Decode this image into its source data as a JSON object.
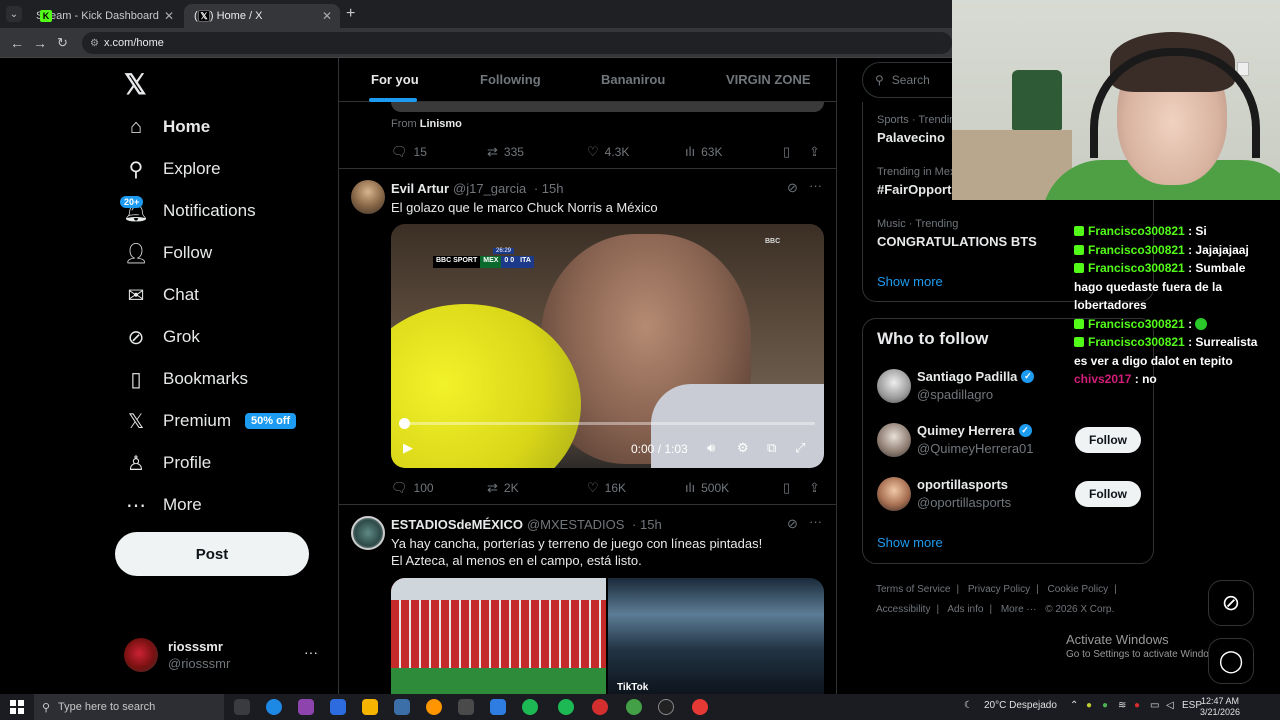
{
  "browser": {
    "tabs": [
      {
        "title": "Stream - Kick Dashboard",
        "active": false
      },
      {
        "title": "(21) Home / X",
        "active": true
      }
    ],
    "url": "x.com/home"
  },
  "nav": {
    "items": [
      {
        "label": "Home",
        "icon": "home-icon"
      },
      {
        "label": "Explore",
        "icon": "search-icon"
      },
      {
        "label": "Notifications",
        "icon": "bell-icon"
      },
      {
        "label": "Follow",
        "icon": "add-user-icon"
      },
      {
        "label": "Chat",
        "icon": "mail-icon"
      },
      {
        "label": "Grok",
        "icon": "grok-icon"
      },
      {
        "label": "Bookmarks",
        "icon": "bookmark-icon"
      },
      {
        "label": "Premium",
        "icon": "x-icon"
      },
      {
        "label": "Profile",
        "icon": "person-icon"
      },
      {
        "label": "More",
        "icon": "more-circle-icon"
      }
    ],
    "notif_badge": "20+",
    "premium_badge": "50% off",
    "post_label": "Post",
    "account": {
      "name": "riosssmr",
      "handle": "@riosssmr"
    }
  },
  "feed": {
    "tabs": [
      "For you",
      "Following",
      "Bananirou",
      "VIRGIN ZONE"
    ],
    "prev": {
      "from_label": "From",
      "from_name": "Linismo",
      "replies": "15",
      "reposts": "335",
      "likes": "4.3K",
      "views": "63K"
    },
    "tweet1": {
      "name": "Evil Artur",
      "handle": "@j17_garcia",
      "time": "· 15h",
      "text": "El golazo que le marco Chuck Norris a México",
      "video": {
        "time": "0:00 / 1:03",
        "score": [
          "BBC SPORT",
          "MEX",
          "0 0",
          "ITA"
        ],
        "clock": "26:29",
        "progress": 0.0
      },
      "replies": "100",
      "reposts": "2K",
      "likes": "16K",
      "views": "500K"
    },
    "tweet2": {
      "name": "ESTADIOSdeMÉXICO",
      "handle": "@MXESTADIOS",
      "time": "· 15h",
      "line1": "Ya hay cancha, porterías y terreno de juego con líneas pintadas!",
      "line2": "El Azteca, al menos en el campo, está listo.",
      "watermark": "TikTok"
    }
  },
  "sidebar": {
    "search_placeholder": "Search",
    "trends": [
      {
        "meta": "Sports · Trending",
        "name": "Palavecino"
      },
      {
        "meta": "Trending in Mexico",
        "name": "#FairOpport"
      },
      {
        "meta": "Music · Trending",
        "name": "CONGRATULATIONS BTS"
      }
    ],
    "show_more": "Show more",
    "who_to_follow": {
      "title": "Who to follow",
      "accounts": [
        {
          "name": "Santiago Padilla",
          "handle": "@spadillagro",
          "verified": true
        },
        {
          "name": "Quimey Herrera",
          "handle": "@QuimeyHerrera01",
          "verified": true
        },
        {
          "name": "oportillasports",
          "handle": "@oportillasports",
          "verified": false
        }
      ],
      "follow_label": "Follow",
      "show_more": "Show more"
    },
    "footer": [
      "Terms of Service",
      "|",
      "Privacy Policy",
      "|",
      "Cookie Policy",
      "|",
      "Accessibility",
      "|",
      "Ads info",
      "|",
      "More ···",
      "© 2026 X Corp."
    ]
  },
  "chat": [
    {
      "user": "Francisco300821",
      "msg": ": Si"
    },
    {
      "user": "Francisco300821",
      "msg": ": Jajajajaaj"
    },
    {
      "user": "Francisco300821",
      "msg": ": Sumbale hago quedaste fuera de la lobertadores"
    },
    {
      "user": "Francisco300821",
      "msg": ":"
    },
    {
      "user": "Francisco300821",
      "msg": ": Surrealista es ver a digo dalot en tepito"
    },
    {
      "user": "chivs2017",
      "msg": ": no"
    }
  ],
  "activate": {
    "title": "Activate Windows",
    "sub": "Go to Settings to activate Windows."
  },
  "taskbar": {
    "search_placeholder": "Type here to search",
    "weather": "20°C  Despejado",
    "lang": "ESP",
    "time": "12:47 AM",
    "date": "3/21/2026"
  },
  "colors": {
    "accent": "#1d9bf0",
    "kick_green": "#53fc18",
    "bg": "#000000"
  }
}
